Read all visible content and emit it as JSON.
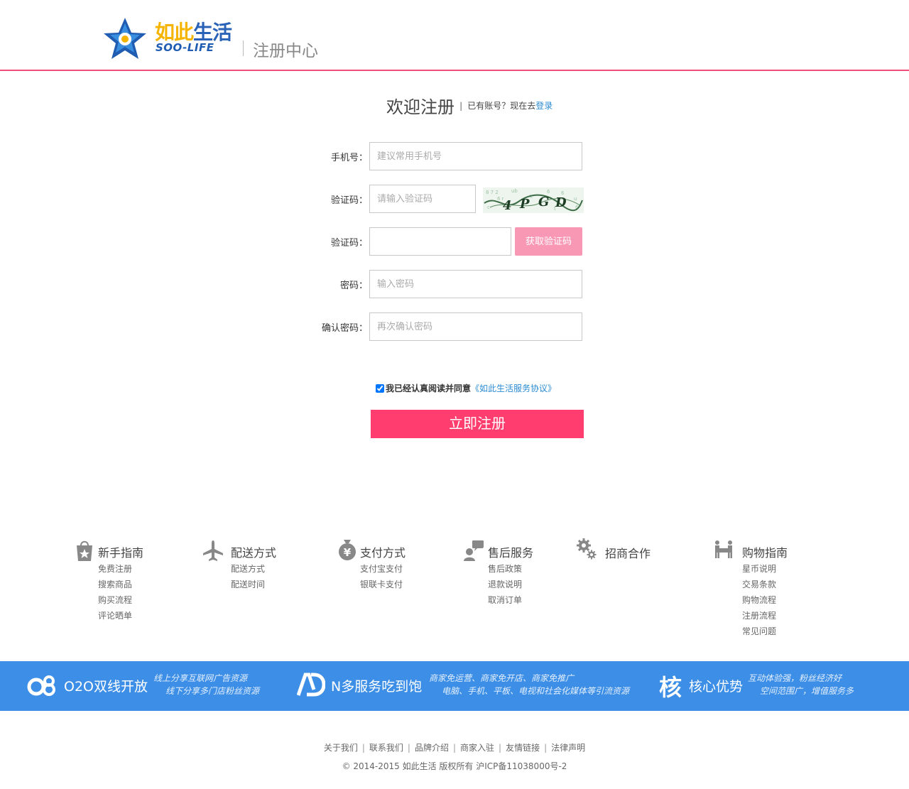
{
  "header": {
    "logo_cn_part1": "如此",
    "logo_cn_part2": "生活",
    "logo_en": "SOO-LIFE",
    "title": "注册中心"
  },
  "welcome": {
    "title": "欢迎注册",
    "separator": "|",
    "text": "已有账号？现在去",
    "login_link": "登录"
  },
  "form": {
    "phone": {
      "label": "手机号：",
      "placeholder": "建议常用手机号"
    },
    "captcha": {
      "label": "验证码：",
      "placeholder": "请输入验证码",
      "image_text": "4PGD"
    },
    "sms_code": {
      "label": "验证码：",
      "placeholder": "",
      "button": "获取验证码"
    },
    "password": {
      "label": "密码：",
      "placeholder": "输入密码"
    },
    "confirm_password": {
      "label": "确认密码：",
      "placeholder": "再次确认密码"
    },
    "agree": {
      "checked": true,
      "text": "我已经认真阅读并同意",
      "link": "《如此生活服务协议》"
    },
    "submit": "立即注册"
  },
  "help": [
    {
      "icon": "shopping-bag-star-icon",
      "title": "新手指南",
      "items": [
        "免费注册",
        "搜索商品",
        "购买流程",
        "评论晒单"
      ]
    },
    {
      "icon": "airplane-icon",
      "title": "配送方式",
      "items": [
        "配送方式",
        "配送时间"
      ]
    },
    {
      "icon": "yuan-money-bag-icon",
      "title": "支付方式",
      "items": [
        "支付宝支付",
        "银联卡支付"
      ]
    },
    {
      "icon": "customer-service-chat-icon",
      "title": "售后服务",
      "items": [
        "售后政策",
        "退款说明",
        "取消订单"
      ]
    },
    {
      "icon": "gears-icon",
      "title": "招商合作",
      "items": []
    },
    {
      "icon": "people-shopping-icon",
      "title": "购物指南",
      "items": [
        "星币说明",
        "交易条款",
        "购物流程",
        "注册流程",
        "常见问题"
      ]
    }
  ],
  "band": [
    {
      "icon": "o2o-logo-icon",
      "title": "O2O双线开放",
      "line1": "线上分享互联网广告资源",
      "line2": "线下分享多门店粉丝资源"
    },
    {
      "icon": "ad-logo-icon",
      "title": "N多服务吃到饱",
      "line1": "商家免运营、商家免开店、商家免推广",
      "line2": "电脑、手机、平板、电视和社会化媒体等引流资源"
    },
    {
      "icon": "he-character-icon",
      "icon_text": "核",
      "title": "核心优势",
      "line1": "互动体验强，粉丝经济好",
      "line2": "空间范围广，增值服务多"
    }
  ],
  "footer": {
    "links": [
      "关于我们",
      "联系我们",
      "品牌介绍",
      "商家入驻",
      "友情链接",
      "法律声明"
    ],
    "separator": "|",
    "copyright": "© 2014-2015 如此生活 版权所有 沪ICP备11038000号-2"
  },
  "colors": {
    "accent_pink": "#ef4e7c",
    "submit_pink": "#ff3e6f",
    "sms_button_pink": "#f898b4",
    "band_blue": "#3c8ee6",
    "link_blue": "#2b8bd1"
  }
}
